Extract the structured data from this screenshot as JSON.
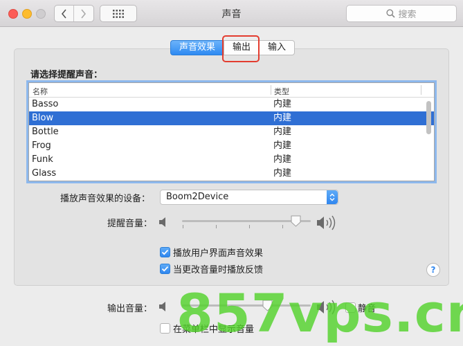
{
  "window": {
    "title": "声音"
  },
  "toolbar": {
    "search_placeholder": "搜索"
  },
  "tabs": [
    {
      "label": "声音效果",
      "active": true
    },
    {
      "label": "输出",
      "active": false,
      "highlighted": true
    },
    {
      "label": "输入",
      "active": false
    }
  ],
  "sound_list": {
    "label": "请选择提醒声音：",
    "columns": [
      "名称",
      "类型"
    ],
    "rows": [
      {
        "name": "Basso",
        "type": "内建",
        "selected": false
      },
      {
        "name": "Blow",
        "type": "内建",
        "selected": true
      },
      {
        "name": "Bottle",
        "type": "内建",
        "selected": false
      },
      {
        "name": "Frog",
        "type": "内建",
        "selected": false
      },
      {
        "name": "Funk",
        "type": "内建",
        "selected": false
      },
      {
        "name": "Glass",
        "type": "内建",
        "selected": false
      }
    ]
  },
  "device": {
    "label": "播放声音效果的设备：",
    "value": "Boom2Device"
  },
  "alert_volume": {
    "label": "提醒音量：",
    "level": 0.92
  },
  "options": [
    {
      "label": "播放用户界面声音效果",
      "checked": true
    },
    {
      "label": "当更改音量时播放反馈",
      "checked": true
    }
  ],
  "output_volume": {
    "label": "输出音量：",
    "level": 0.68,
    "mute_label": "静音",
    "muted": false
  },
  "menubar_option": {
    "label": "在菜单栏中显示音量",
    "checked": false
  },
  "watermark": "857vps.cn",
  "colors": {
    "accent": "#2f86ef",
    "selection": "#2f6fd4",
    "highlight_box": "#e33c2f"
  }
}
